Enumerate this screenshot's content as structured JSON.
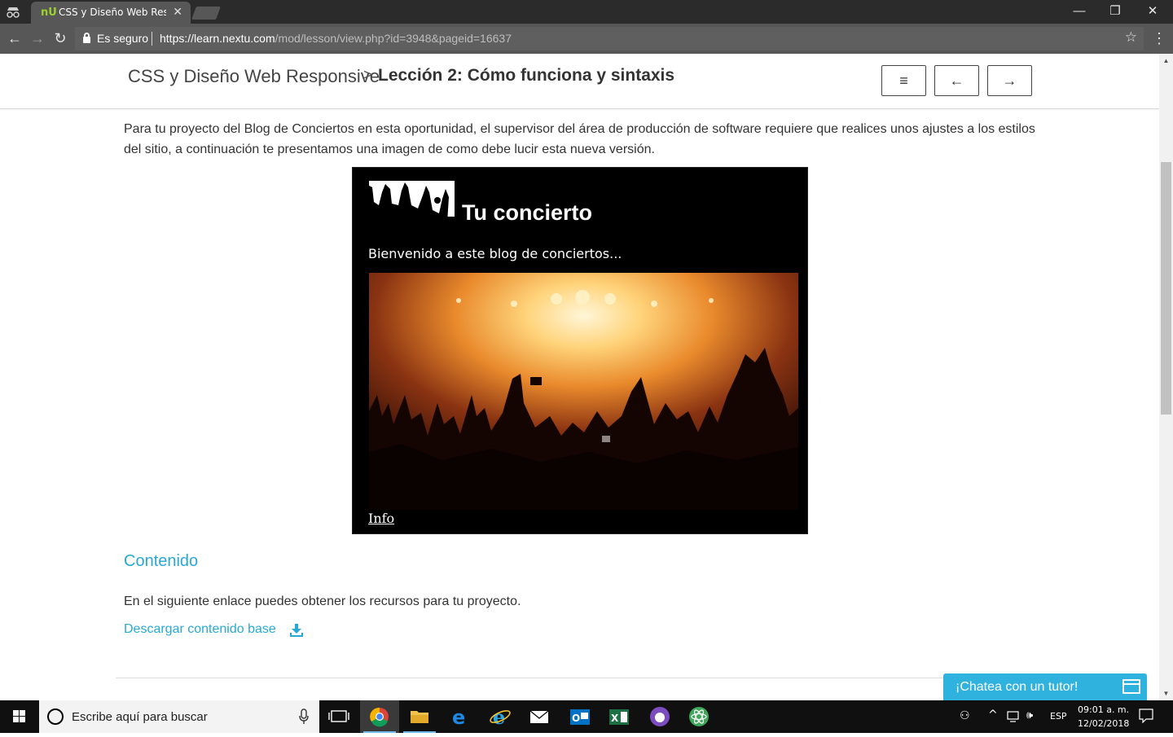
{
  "browser": {
    "tab_title": "CSS y Diseño Web Respo",
    "tab_favicon": "nU",
    "security_label": "Es seguro",
    "url_host": "https://learn.nextu.com",
    "url_path": "/mod/lesson/view.php?id=3948&pageid=16637"
  },
  "header": {
    "course": "CSS y Diseño Web Responsive",
    "separator": ">",
    "lesson": "Lección 2: Cómo funciona y sintaxis",
    "menu_icon": "≡",
    "prev_icon": "←",
    "next_icon": "→"
  },
  "content": {
    "intro": "Para tu proyecto del Blog de Conciertos en esta oportunidad, el supervisor del área de producción de software requiere que realices unos ajustes a los estilos del sitio, a continuación te presentamos una imagen de como debe lucir esta nueva versión.",
    "preview": {
      "title": "Tu concierto",
      "welcome": "Bienvenido a este blog de conciertos...",
      "info_link": "Info"
    },
    "section_title": "Contenido",
    "resources_text": "En el siguiente enlace puedes obtener los recursos para tu proyecto.",
    "download_link": "Descargar contenido base"
  },
  "chat": {
    "label": "¡Chatea con un tutor!"
  },
  "taskbar": {
    "search_placeholder": "Escribe aquí para buscar",
    "language": "ESP",
    "time": "09:01 a. m.",
    "date": "12/02/2018",
    "pinned_apps": [
      "task-view-icon",
      "chrome-icon",
      "file-explorer-icon",
      "edge-icon",
      "internet-explorer-icon",
      "mail-icon",
      "outlook-icon",
      "excel-icon",
      "app-purple-icon",
      "atom-icon"
    ]
  },
  "colors": {
    "accent": "#29a8d6",
    "chrome_dark": "#2b2b2b",
    "chrome_bar": "#575757"
  }
}
